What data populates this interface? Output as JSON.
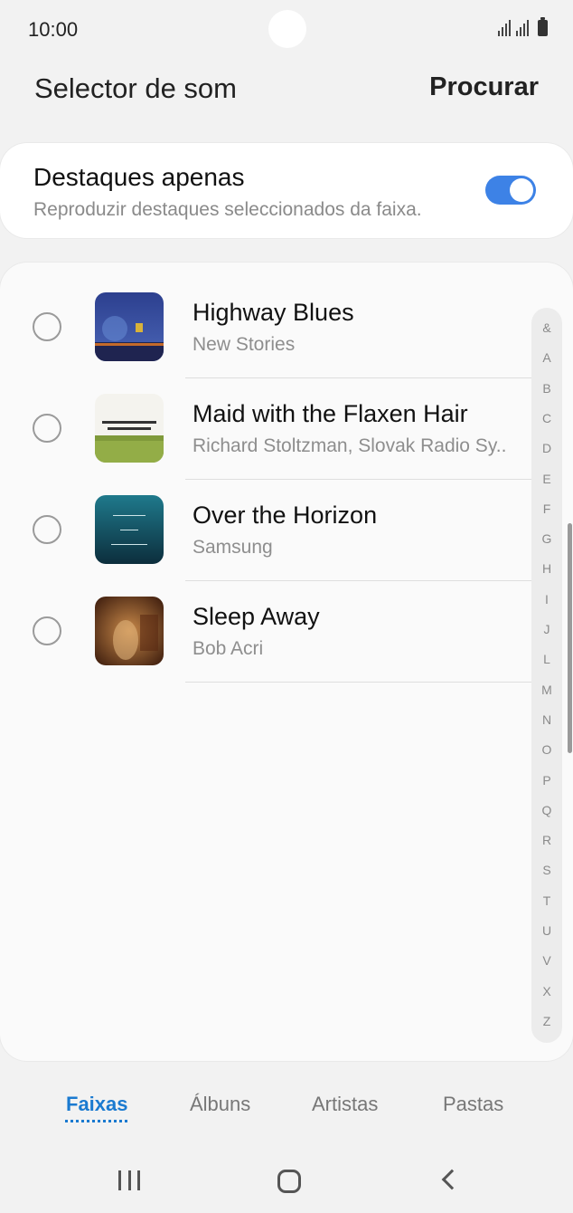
{
  "status_bar": {
    "time": "10:00"
  },
  "header": {
    "title": "Selector de som",
    "action": "Procurar"
  },
  "highlights": {
    "title": "Destaques apenas",
    "subtitle": "Reproduzir destaques seleccionados da faixa.",
    "enabled": true,
    "accent_color": "#3d82e6"
  },
  "tracks": [
    {
      "title": "Highway Blues",
      "artist": "New Stories",
      "selected": false
    },
    {
      "title": "Maid with the Flaxen Hair",
      "artist": "Richard Stoltzman, Slovak Radio Sy..",
      "selected": false
    },
    {
      "title": "Over the Horizon",
      "artist": "Samsung",
      "selected": false
    },
    {
      "title": "Sleep Away",
      "artist": "Bob Acri",
      "selected": false
    }
  ],
  "index_letters": [
    "&",
    "A",
    "B",
    "C",
    "D",
    "E",
    "F",
    "G",
    "H",
    "I",
    "J",
    "L",
    "M",
    "N",
    "O",
    "P",
    "Q",
    "R",
    "S",
    "T",
    "U",
    "V",
    "X",
    "Z"
  ],
  "tabs": [
    {
      "label": "Faixas",
      "active": true
    },
    {
      "label": "Álbuns",
      "active": false
    },
    {
      "label": "Artistas",
      "active": false
    },
    {
      "label": "Pastas",
      "active": false
    }
  ],
  "nav": {
    "recents_icon": "recents-icon",
    "home_icon": "home-icon",
    "back_icon": "back-icon"
  }
}
